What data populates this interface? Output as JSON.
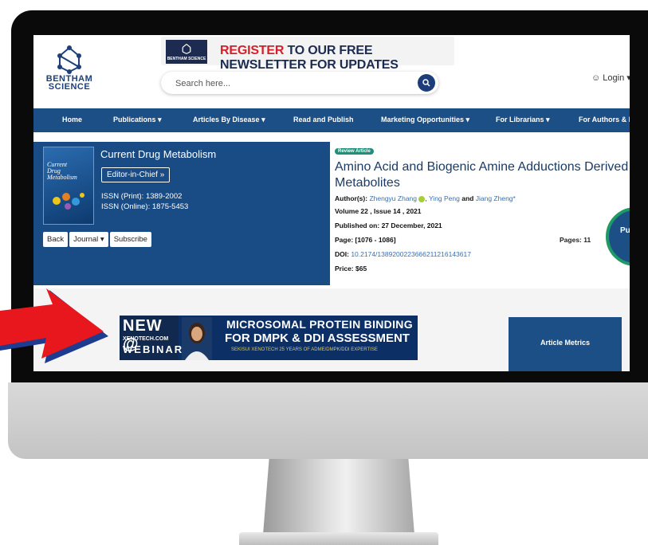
{
  "header": {
    "logo_text_1": "BENTHAM",
    "logo_text_2": "SCIENCE",
    "ad_badge": "BENTHAM SCIENCE",
    "ad_text_red": "REGISTER",
    "ad_text_rest": " TO OUR FREE NEWSLETTER FOR UPDATES",
    "search_placeholder": "Search here...",
    "login_label": "Login"
  },
  "nav": {
    "items": [
      {
        "label": "Home"
      },
      {
        "label": "Publications"
      },
      {
        "label": "Articles By Disease"
      },
      {
        "label": "Read and Publish"
      },
      {
        "label": "Marketing Opportunities"
      },
      {
        "label": "For Librarians"
      },
      {
        "label": "For Authors & Ed"
      }
    ]
  },
  "journal": {
    "cover_title": "Current Drug Metabolism",
    "title": "Current Drug Metabolism",
    "editor_button": "Editor-in-Chief »",
    "issn_print": "ISSN (Print): 1389-2002",
    "issn_online": "ISSN (Online): 1875-5453",
    "buttons": {
      "back": "Back",
      "journal": "Journal",
      "subscribe": "Subscribe"
    }
  },
  "article": {
    "type_badge": "Review Article",
    "title": "Amino Acid and Biogenic Amine Adductions Derived from Metabolites",
    "authors_label": "Author(s):",
    "author_1": "Zhengyu Zhang",
    "author_2": "Ying Peng",
    "and_text": "and",
    "author_3": "Jiang Zheng*",
    "volume": "Volume 22 , Issue 14 , 2021",
    "published_label": "Published on:",
    "published_date": "27 December, 2021",
    "page_label": "Page:",
    "page_range": "[1076 - 1086]",
    "pages_label": "Pages:",
    "pages_count": "11",
    "doi_label": "DOI:",
    "doi": "10.2174/1389200223666211216143617",
    "price_label": "Price:",
    "price": "$65",
    "circle_label": "Pur"
  },
  "banner": {
    "new": "NEW @",
    "xeno": "XENOTECH.COM",
    "webinar": "WEBINAR",
    "line1": "MICROSOMAL PROTEIN BINDING",
    "line2": "FOR DMPK & DDI ASSESSMENT",
    "line3": "SEKISUI  XENOTECH  25 YEARS OF ADME/DMPK/DDI EXPERTISE"
  },
  "metrics": {
    "label": "Article Metrics"
  },
  "colors": {
    "nav": "#1b4f86",
    "accent_red": "#d3212b",
    "badge_green": "#1f8f7a"
  }
}
